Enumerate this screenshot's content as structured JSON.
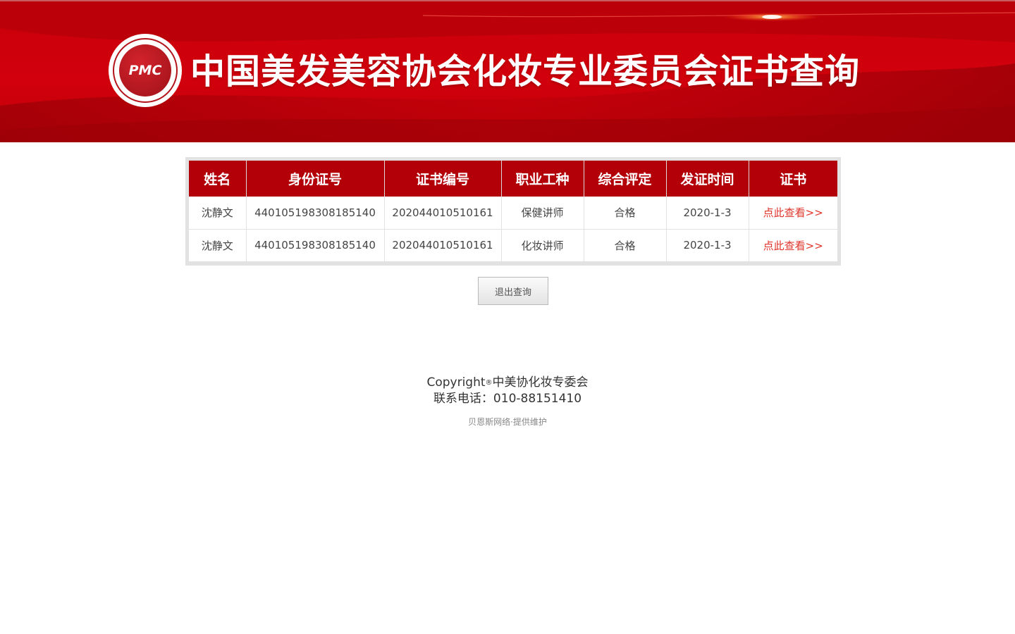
{
  "banner": {
    "logo_text": "PMC",
    "title": "中国美发美容协会化妆专业委员会证书查询"
  },
  "colors": {
    "brand_red": "#c9000a",
    "header_red": "#b30008",
    "link_red": "#e0342b"
  },
  "table": {
    "headers": [
      "姓名",
      "身份证号",
      "证书编号",
      "职业工种",
      "综合评定",
      "发证时间",
      "证书"
    ],
    "rows": [
      [
        "沈静文",
        "440105198308185140",
        "202044010510161",
        "保健讲师",
        "合格",
        "2020-1-3",
        "点此查看>>"
      ],
      [
        "沈静文",
        "440105198308185140",
        "202044010510161",
        "化妆讲师",
        "合格",
        "2020-1-3",
        "点此查看>>"
      ]
    ]
  },
  "exit_button": "退出查询",
  "footer": {
    "copyright_prefix": "Copyright",
    "copyright_mark": "®",
    "copyright_org": "中美协化妆专委会",
    "phone": "联系电话：010-88151410",
    "maintenance": "贝恩斯网络·提供维护"
  }
}
